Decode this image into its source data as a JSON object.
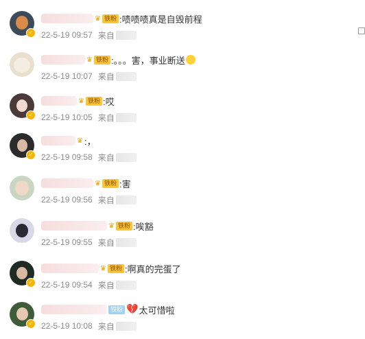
{
  "source_prefix": "来自",
  "colors": {
    "badge_gold": "#fdc536",
    "badge_blue": "#9fd2f5",
    "meta": "#8c8c8c"
  },
  "comments": [
    {
      "badge": "铁粉",
      "text": ":啧啧啧真是自毁前程",
      "time": "22-5-19 09:57"
    },
    {
      "badge": "铁粉",
      "text": ":。。。害，事业断送",
      "time": "22-5-19 10:07"
    },
    {
      "badge": "铁粉",
      "text": ":哎",
      "time": "22-5-19 10:05"
    },
    {
      "badge": "",
      "text": ":，",
      "time": "22-5-19 09:58"
    },
    {
      "badge": "铁粉",
      "text": ":害",
      "time": "22-5-19 09:56"
    },
    {
      "badge": "铁粉",
      "text": ":唉豁",
      "time": "22-5-19 09:55"
    },
    {
      "badge": "铁粉",
      "text": ":啊真的完蛋了",
      "time": "22-5-19 09:54"
    },
    {
      "badge": "铁粉",
      "text": "太可惜啦",
      "time": "22-5-19 10:08"
    }
  ]
}
